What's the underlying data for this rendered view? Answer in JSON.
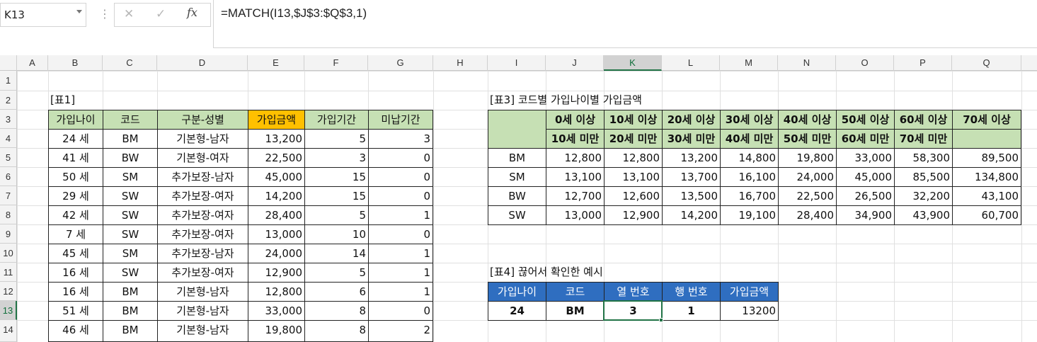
{
  "formula_bar": {
    "name_box": "K13",
    "cancel_icon": "✕",
    "enter_icon": "✓",
    "fx_label": "fx",
    "formula": "=MATCH(I13,$J$3:$Q$3,1)"
  },
  "columns": [
    "A",
    "B",
    "C",
    "D",
    "E",
    "F",
    "G",
    "H",
    "I",
    "J",
    "K",
    "L",
    "M",
    "N",
    "O",
    "P",
    "Q"
  ],
  "rows": [
    "1",
    "2",
    "3",
    "4",
    "5",
    "6",
    "7",
    "8",
    "9",
    "10",
    "11",
    "12",
    "13",
    "14"
  ],
  "selected_cell": "K13",
  "table1": {
    "title": "[표1]",
    "headers": [
      "가입나이",
      "코드",
      "구분-성별",
      "가입금액",
      "가입기간",
      "미납기간"
    ],
    "rows": [
      [
        "24 세",
        "BM",
        "기본형-남자",
        "13,200",
        "5",
        "3"
      ],
      [
        "41 세",
        "BW",
        "기본형-여자",
        "22,500",
        "3",
        "0"
      ],
      [
        "50 세",
        "SM",
        "추가보장-남자",
        "45,000",
        "15",
        "0"
      ],
      [
        "29 세",
        "SW",
        "추가보장-여자",
        "14,200",
        "15",
        "0"
      ],
      [
        "42 세",
        "SW",
        "추가보장-여자",
        "28,400",
        "5",
        "1"
      ],
      [
        "7 세",
        "SW",
        "추가보장-여자",
        "13,000",
        "10",
        "0"
      ],
      [
        "45 세",
        "SM",
        "추가보장-남자",
        "24,000",
        "14",
        "1"
      ],
      [
        "16 세",
        "SW",
        "추가보장-여자",
        "12,900",
        "5",
        "1"
      ],
      [
        "16 세",
        "BM",
        "기본형-남자",
        "12,800",
        "6",
        "1"
      ],
      [
        "51 세",
        "BM",
        "기본형-남자",
        "33,000",
        "8",
        "0"
      ],
      [
        "46 세",
        "BM",
        "기본형-남자",
        "19,800",
        "8",
        "2"
      ]
    ]
  },
  "table3": {
    "title": "[표3] 코드별 가입나이별 가입금액",
    "header_top": [
      "0세 이상",
      "10세 이상",
      "20세 이상",
      "30세 이상",
      "40세 이상",
      "50세 이상",
      "60세 이상",
      "70세 이상"
    ],
    "header_bottom": [
      "10세 미만",
      "20세 미만",
      "30세 미만",
      "40세 미만",
      "50세 미만",
      "60세 미만",
      "70세 미만",
      ""
    ],
    "rows": [
      {
        "code": "BM",
        "values": [
          "12,800",
          "12,800",
          "13,200",
          "14,800",
          "19,800",
          "33,000",
          "58,300",
          "89,500"
        ]
      },
      {
        "code": "SM",
        "values": [
          "13,100",
          "13,100",
          "13,700",
          "16,100",
          "24,000",
          "45,000",
          "85,500",
          "134,800"
        ]
      },
      {
        "code": "BW",
        "values": [
          "12,700",
          "12,600",
          "13,500",
          "16,700",
          "22,500",
          "26,500",
          "32,200",
          "43,100"
        ]
      },
      {
        "code": "SW",
        "values": [
          "13,000",
          "12,900",
          "14,200",
          "19,100",
          "28,400",
          "34,900",
          "43,900",
          "60,700"
        ]
      }
    ]
  },
  "table4": {
    "title": "[표4] 끊어서 확인한 예시",
    "headers": [
      "가입나이",
      "코드",
      "열 번호",
      "행 번호",
      "가입금액"
    ],
    "values": [
      "24",
      "BM",
      "3",
      "1",
      "13200"
    ]
  },
  "colors": {
    "green_header": "#c6e0b4",
    "orange_header": "#ffc000",
    "blue_header": "#2f6ec0",
    "excel_green": "#217346"
  }
}
